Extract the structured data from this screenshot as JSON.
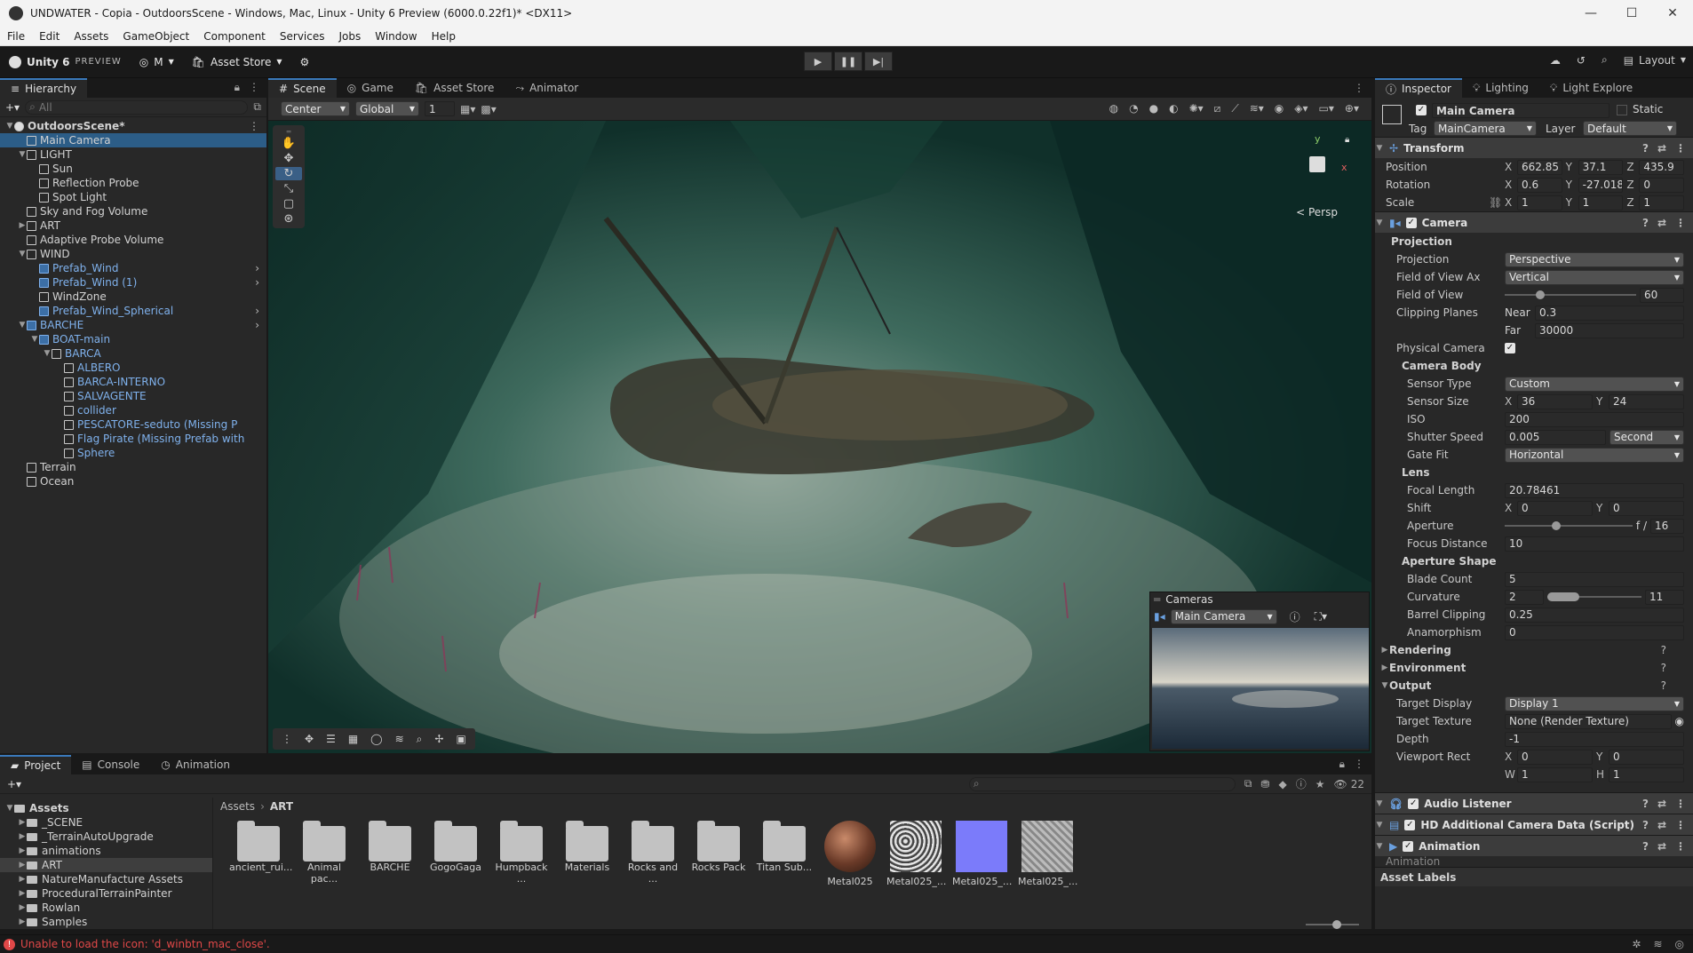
{
  "window": {
    "title": "UNDWATER - Copia - OutdoorsScene - Windows, Mac, Linux - Unity 6 Preview (6000.0.22f1)* <DX11>"
  },
  "menu": [
    "File",
    "Edit",
    "Assets",
    "GameObject",
    "Component",
    "Services",
    "Jobs",
    "Window",
    "Help"
  ],
  "toolbar": {
    "unity_label": "Unity 6",
    "preview": "PREVIEW",
    "account": "M",
    "asset_store": "Asset Store",
    "layout": "Layout"
  },
  "hierarchy": {
    "tab": "Hierarchy",
    "search_placeholder": "All",
    "rows": [
      {
        "label": "OutdoorsScene*",
        "indent": 0,
        "type": "scene",
        "arrow": "▼"
      },
      {
        "label": "Main Camera",
        "indent": 1,
        "type": "obj",
        "selected": true
      },
      {
        "label": "LIGHT",
        "indent": 1,
        "type": "obj",
        "arrow": "▼"
      },
      {
        "label": "Sun",
        "indent": 2,
        "type": "obj"
      },
      {
        "label": "Reflection Probe",
        "indent": 2,
        "type": "obj"
      },
      {
        "label": "Spot Light",
        "indent": 2,
        "type": "obj"
      },
      {
        "label": "Sky and Fog Volume",
        "indent": 1,
        "type": "obj"
      },
      {
        "label": "ART",
        "indent": 1,
        "type": "obj",
        "arrow": "▶"
      },
      {
        "label": "Adaptive Probe Volume",
        "indent": 1,
        "type": "obj"
      },
      {
        "label": "WIND",
        "indent": 1,
        "type": "obj",
        "arrow": "▼"
      },
      {
        "label": "Prefab_Wind",
        "indent": 2,
        "type": "prefab",
        "chev": true
      },
      {
        "label": "Prefab_Wind (1)",
        "indent": 2,
        "type": "prefab",
        "chev": true
      },
      {
        "label": "WindZone",
        "indent": 2,
        "type": "obj"
      },
      {
        "label": "Prefab_Wind_Spherical",
        "indent": 2,
        "type": "prefab",
        "chev": true
      },
      {
        "label": "BARCHE",
        "indent": 1,
        "type": "prefab",
        "arrow": "▼",
        "chev": true
      },
      {
        "label": "BOAT-main",
        "indent": 2,
        "type": "prefab",
        "arrow": "▼"
      },
      {
        "label": "BARCA",
        "indent": 3,
        "type": "prefabtext",
        "arrow": "▼"
      },
      {
        "label": "ALBERO",
        "indent": 4,
        "type": "prefabtext"
      },
      {
        "label": "BARCA-INTERNO",
        "indent": 4,
        "type": "prefabtext"
      },
      {
        "label": "SALVAGENTE",
        "indent": 4,
        "type": "prefabtext"
      },
      {
        "label": "collider",
        "indent": 4,
        "type": "prefabtext"
      },
      {
        "label": "PESCATORE-seduto (Missing P",
        "indent": 4,
        "type": "prefabtext"
      },
      {
        "label": "Flag Pirate (Missing Prefab with",
        "indent": 4,
        "type": "prefabtext"
      },
      {
        "label": "Sphere",
        "indent": 4,
        "type": "prefabtext"
      },
      {
        "label": "Terrain",
        "indent": 1,
        "type": "obj"
      },
      {
        "label": "Ocean",
        "indent": 1,
        "type": "obj"
      }
    ]
  },
  "scene_tabs": [
    "Scene",
    "Game",
    "Asset Store",
    "Animator"
  ],
  "scene_toolbar": {
    "pivot": "Center",
    "space": "Global",
    "grid": "1"
  },
  "scene": {
    "persp_label": "< Persp",
    "gizmo_y": "y",
    "gizmo_x": "x"
  },
  "camera_overlay": {
    "title": "Cameras",
    "camera": "Main Camera"
  },
  "inspector": {
    "tabs": [
      "Inspector",
      "Lighting",
      "Light Explore"
    ],
    "object_name": "Main Camera",
    "static": "Static",
    "tag_label": "Tag",
    "tag": "MainCamera",
    "layer_label": "Layer",
    "layer": "Default",
    "transform": {
      "title": "Transform",
      "position": {
        "label": "Position",
        "x": "662.85",
        "y": "37.1",
        "z": "435.9"
      },
      "rotation": {
        "label": "Rotation",
        "x": "0.6",
        "y": "-27.018",
        "z": "0"
      },
      "scale": {
        "label": "Scale",
        "x": "1",
        "y": "1",
        "z": "1"
      }
    },
    "camera": {
      "title": "Camera",
      "projection_header": "Projection",
      "projection": {
        "label": "Projection",
        "value": "Perspective"
      },
      "fov_axis": {
        "label": "Field of View Ax",
        "value": "Vertical"
      },
      "fov": {
        "label": "Field of View",
        "value": "60",
        "fraction": 0.27
      },
      "clipping": {
        "label": "Clipping Planes",
        "near_label": "Near",
        "near": "0.3",
        "far_label": "Far",
        "far": "30000"
      },
      "physical": {
        "label": "Physical Camera"
      },
      "body_header": "Camera Body",
      "sensor_type": {
        "label": "Sensor Type",
        "value": "Custom"
      },
      "sensor_size": {
        "label": "Sensor Size",
        "x": "36",
        "y": "24"
      },
      "iso": {
        "label": "ISO",
        "value": "200"
      },
      "shutter": {
        "label": "Shutter Speed",
        "value": "0.005",
        "unit": "Second"
      },
      "gate_fit": {
        "label": "Gate Fit",
        "value": "Horizontal"
      },
      "lens_header": "Lens",
      "focal": {
        "label": "Focal Length",
        "value": "20.78461"
      },
      "shift": {
        "label": "Shift",
        "x": "0",
        "y": "0"
      },
      "aperture": {
        "label": "Aperture",
        "prefix": "f /",
        "value": "16",
        "fraction": 0.4
      },
      "focus": {
        "label": "Focus Distance",
        "value": "10"
      },
      "shape_header": "Aperture Shape",
      "blade": {
        "label": "Blade Count",
        "value": "5"
      },
      "curvature": {
        "label": "Curvature",
        "min": "2",
        "max": "11"
      },
      "barrel": {
        "label": "Barrel Clipping",
        "value": "0.25"
      },
      "anamorph": {
        "label": "Anamorphism",
        "value": "0"
      },
      "rendering": "Rendering",
      "environment": "Environment",
      "output": "Output",
      "target_display": {
        "label": "Target Display",
        "value": "Display 1"
      },
      "target_texture": {
        "label": "Target Texture",
        "value": "None (Render Texture)"
      },
      "depth": {
        "label": "Depth",
        "value": "-1"
      },
      "viewport": {
        "label": "Viewport Rect",
        "x": "0",
        "y": "0",
        "w": "1",
        "h": "1"
      }
    },
    "components": [
      "Audio Listener",
      "HD Additional Camera Data (Script)",
      "Animation"
    ],
    "animation_row": "Animation",
    "asset_labels": "Asset Labels"
  },
  "project": {
    "tabs": [
      "Project",
      "Console",
      "Animation"
    ],
    "count": "22",
    "breadcrumb": [
      "Assets",
      "ART"
    ],
    "tree": [
      {
        "label": "Assets",
        "indent": 0,
        "bold": true
      },
      {
        "label": "_SCENE",
        "indent": 1
      },
      {
        "label": "_TerrainAutoUpgrade",
        "indent": 1
      },
      {
        "label": "animations",
        "indent": 1
      },
      {
        "label": "ART",
        "indent": 1,
        "selected": true
      },
      {
        "label": "NatureManufacture Assets",
        "indent": 1
      },
      {
        "label": "ProceduralTerrainPainter",
        "indent": 1
      },
      {
        "label": "Rowlan",
        "indent": 1
      },
      {
        "label": "Samples",
        "indent": 1
      }
    ],
    "assets": [
      {
        "label": "ancient_rui...",
        "kind": "folder"
      },
      {
        "label": "Animal pac...",
        "kind": "folder"
      },
      {
        "label": "BARCHE",
        "kind": "folder"
      },
      {
        "label": "GogoGaga",
        "kind": "folder"
      },
      {
        "label": "Humpback ...",
        "kind": "folder"
      },
      {
        "label": "Materials",
        "kind": "folder"
      },
      {
        "label": "Rocks and ...",
        "kind": "folder"
      },
      {
        "label": "Rocks Pack",
        "kind": "folder"
      },
      {
        "label": "Titan Sub...",
        "kind": "folder"
      },
      {
        "label": "Metal025",
        "kind": "sphere"
      },
      {
        "label": "Metal025_...",
        "kind": "noise"
      },
      {
        "label": "Metal025_...",
        "kind": "normal"
      },
      {
        "label": "Metal025_...",
        "kind": "gray"
      }
    ]
  },
  "status": {
    "error": "Unable to load the icon: 'd_winbtn_mac_close'."
  },
  "colors": {
    "accent": "#3a79bb",
    "selection": "#2c5d87",
    "prefab": "#7fb1ec",
    "error": "#e04848"
  }
}
